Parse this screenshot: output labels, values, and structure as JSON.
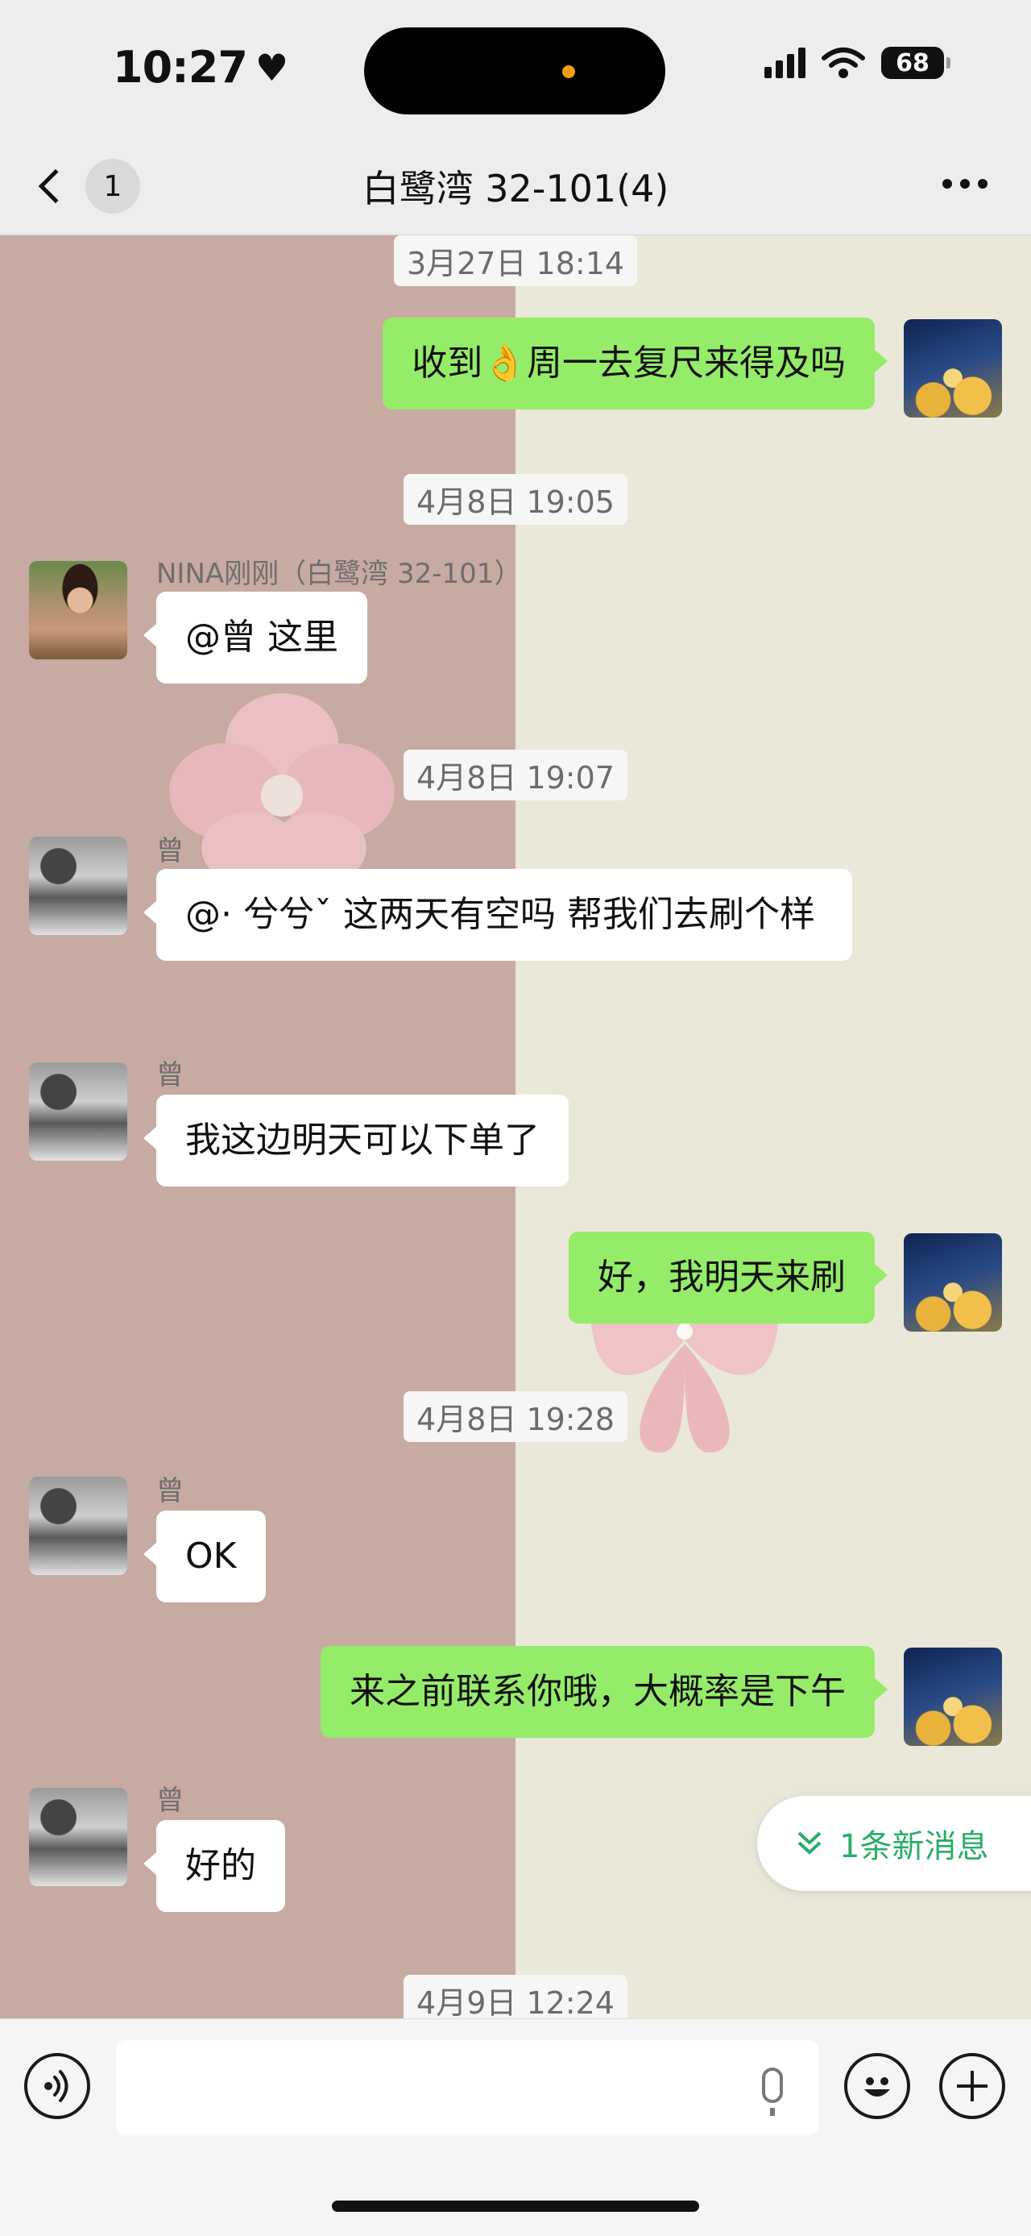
{
  "status_bar": {
    "time": "10:27",
    "battery": "68"
  },
  "nav": {
    "back_count": "1",
    "title": "白鹭湾 32-101(4)"
  },
  "timestamps": [
    "3月27日 18:14",
    "4月8日 19:05",
    "4月8日 19:07",
    "4月8日 19:28",
    "4月9日 12:24"
  ],
  "messages": [
    {
      "side": "out",
      "text": "收到👌周一去复尺来得及吗"
    },
    {
      "side": "in",
      "sender": "NINA刚刚（白鹭湾 32-101）",
      "text": "@曾 这里"
    },
    {
      "side": "in",
      "sender": "曾",
      "text": "@· 兮兮ˇ 这两天有空吗 帮我们去刷个样"
    },
    {
      "side": "in",
      "sender": "曾",
      "text": "我这边明天可以下单了"
    },
    {
      "side": "out",
      "text": "好，我明天来刷"
    },
    {
      "side": "in",
      "sender": "曾",
      "text": "OK"
    },
    {
      "side": "out",
      "text": "来之前联系你哦，大概率是下午"
    },
    {
      "side": "in",
      "sender": "曾",
      "text": "好的"
    }
  ],
  "new_message_pill": "1条新消息",
  "icons": [
    "heart-icon",
    "signal-icon",
    "wifi-icon",
    "battery-icon",
    "back-icon",
    "more-icon",
    "voice-icon",
    "mic-icon",
    "emoji-icon",
    "plus-icon",
    "chevron-down-icon"
  ],
  "colors": {
    "outgoing_bubble": "#95ec69",
    "incoming_bubble": "#ffffff",
    "accent": "#2aae67",
    "bg_left": "#c7aaa1",
    "bg_right": "#eae8d9"
  }
}
